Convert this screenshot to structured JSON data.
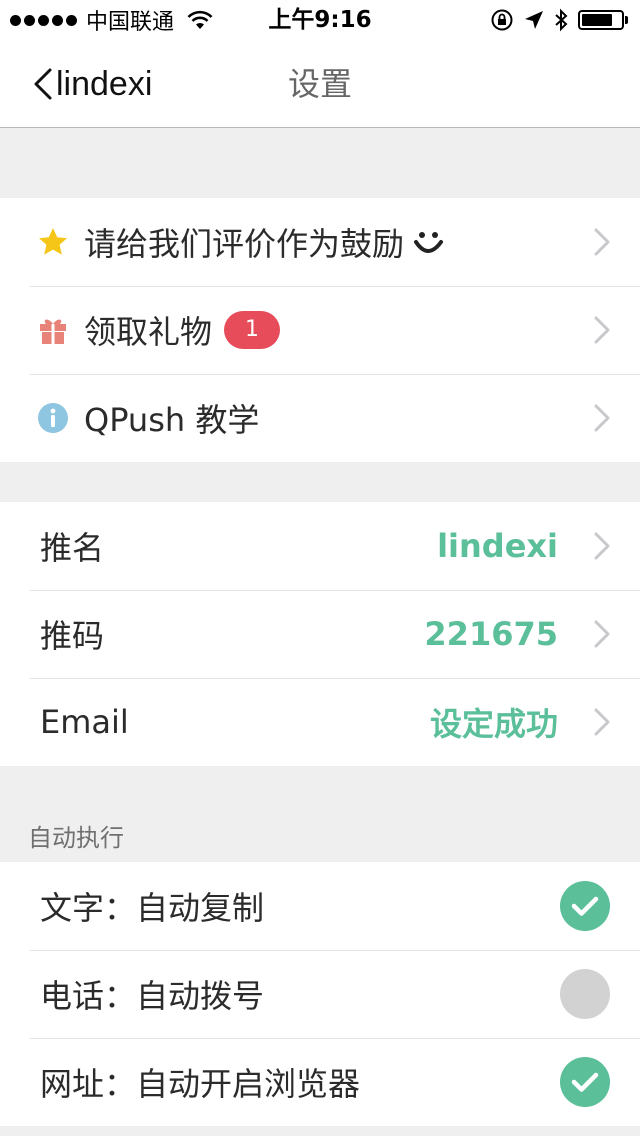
{
  "status": {
    "carrier": "中国联通",
    "time": "上午9:16"
  },
  "nav": {
    "back_label": "lindexi",
    "title": "设置"
  },
  "group1": [
    {
      "icon": "star-icon",
      "label": "请给我们评价作为鼓励",
      "smiley": true
    },
    {
      "icon": "gift-icon",
      "label": "领取礼物",
      "badge": "1"
    },
    {
      "icon": "info-icon",
      "label": "QPush 教学"
    }
  ],
  "group2": [
    {
      "label": "推名",
      "value": "lindexi"
    },
    {
      "label": "推码",
      "value": "221675"
    },
    {
      "label": "Email",
      "value": "设定成功"
    }
  ],
  "section_auto": {
    "header": "自动执行",
    "items": [
      {
        "label": "文字：自动复制",
        "enabled": true
      },
      {
        "label": "电话：自动拨号",
        "enabled": false
      },
      {
        "label": "网址：自动开启浏览器",
        "enabled": true
      }
    ]
  },
  "colors": {
    "accent_green": "#5bbf9a",
    "badge_red": "#e74c5a",
    "star_yellow": "#f5c518",
    "gift_red": "#e8837a",
    "info_blue": "#8ec5e0",
    "toggle_off": "#d2d2d2"
  }
}
